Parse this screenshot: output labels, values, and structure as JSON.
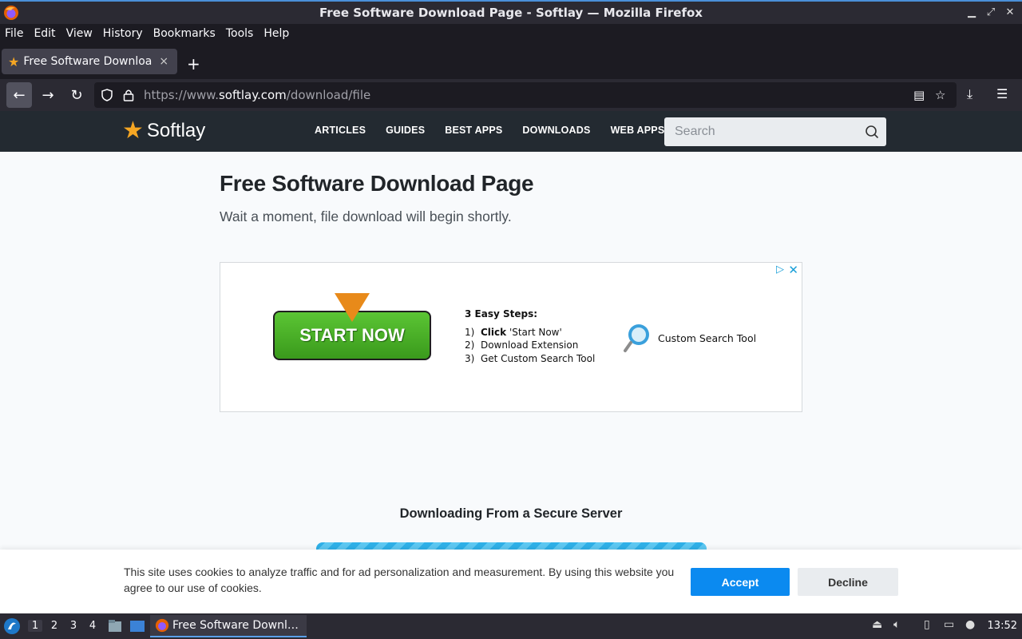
{
  "window": {
    "title": "Free Software Download Page - Softlay — Mozilla Firefox"
  },
  "menubar": [
    "File",
    "Edit",
    "View",
    "History",
    "Bookmarks",
    "Tools",
    "Help"
  ],
  "tab": {
    "label": "Free Software Download",
    "close": "×",
    "new_tab": "+"
  },
  "urlbar": {
    "prefix": "https://www.",
    "domain": "softlay.com",
    "path": "/download/file"
  },
  "site": {
    "logo_text": "Softlay",
    "nav": [
      "ARTICLES",
      "GUIDES",
      "BEST APPS",
      "DOWNLOADS",
      "WEB APPS"
    ],
    "search_placeholder": "Search"
  },
  "content": {
    "heading": "Free Software Download Page",
    "subheading": "Wait a moment, file download will begin shortly.",
    "download_title": "Downloading From a Secure Server"
  },
  "ad": {
    "cta": "START NOW",
    "steps_title": "3 Easy Steps:",
    "steps": [
      {
        "num": "1)",
        "bold": "Click",
        "text": "'Start Now'"
      },
      {
        "num": "2)",
        "bold": "",
        "text": "Download Extension"
      },
      {
        "num": "3)",
        "bold": "",
        "text": "Get Custom Search Tool"
      }
    ],
    "tool_name": "Custom Search Tool"
  },
  "cookie": {
    "text": "This site uses cookies to analyze traffic and for ad personalization and measurement. By using this website you agree to our use of cookies.",
    "accept": "Accept",
    "decline": "Decline"
  },
  "taskbar": {
    "workspaces": [
      "1",
      "2",
      "3",
      "4"
    ],
    "task_label": "Free Software Downl…",
    "clock": "13:52"
  },
  "colors": {
    "accent_blue": "#0b8af0",
    "logo_star": "#f5a623",
    "header_bg": "#232a31"
  }
}
